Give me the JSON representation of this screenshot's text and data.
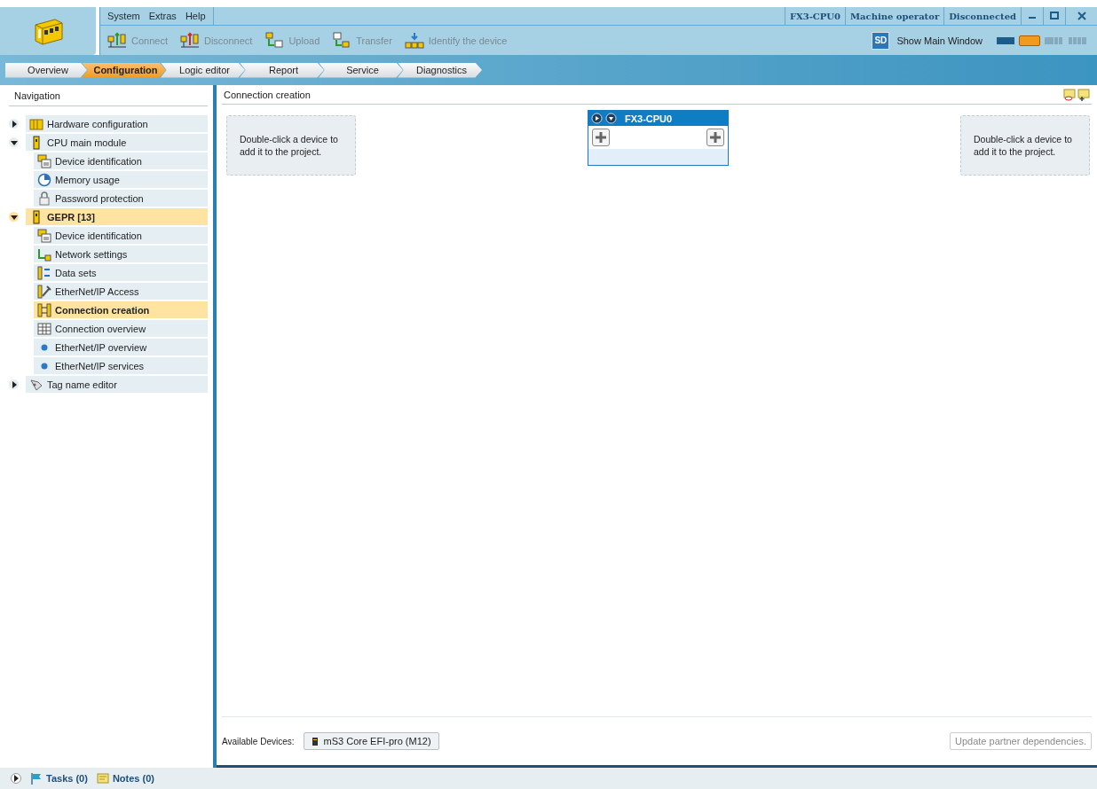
{
  "menu": [
    "System",
    "Extras",
    "Help"
  ],
  "status": [
    "FX3-CPU0",
    "Machine operator",
    "Disconnected"
  ],
  "toolbar": [
    {
      "label": "Connect",
      "kind": "connect",
      "disabled": true
    },
    {
      "label": "Disconnect",
      "kind": "disconnect",
      "disabled": true
    },
    {
      "label": "Upload",
      "kind": "upload",
      "disabled": true
    },
    {
      "label": "Transfer",
      "kind": "transfer",
      "disabled": true
    },
    {
      "label": "Identify the device",
      "kind": "identify",
      "disabled": true
    }
  ],
  "main_window": {
    "badge": "SD",
    "label": "Show Main Window"
  },
  "layouts": [
    {
      "kind": "single",
      "selected": false
    },
    {
      "kind": "split",
      "selected": true
    },
    {
      "kind": "triple",
      "selected": false
    },
    {
      "kind": "quad",
      "selected": false
    }
  ],
  "tabs": [
    {
      "label": "Overview",
      "selected": false
    },
    {
      "label": "Configuration",
      "selected": true
    },
    {
      "label": "Logic editor",
      "selected": false
    },
    {
      "label": "Report",
      "selected": false
    },
    {
      "label": "Service",
      "selected": false
    },
    {
      "label": "Diagnostics",
      "selected": false
    }
  ],
  "navigation": {
    "title": "Navigation",
    "items": [
      {
        "label": "Hardware configuration",
        "kind": "hardware",
        "expanded": false,
        "selected": false
      },
      {
        "label": "CPU main module",
        "kind": "module",
        "expanded": true,
        "selected": false,
        "children": [
          {
            "label": "Device identification",
            "kind": "device-id",
            "selected": false
          },
          {
            "label": "Memory usage",
            "kind": "memory",
            "selected": false
          },
          {
            "label": "Password protection",
            "kind": "password",
            "selected": false
          }
        ]
      },
      {
        "label": "GEPR [13]",
        "kind": "module",
        "expanded": true,
        "selected": true,
        "children": [
          {
            "label": "Device identification",
            "kind": "device-id",
            "selected": false
          },
          {
            "label": "Network settings",
            "kind": "network",
            "selected": false
          },
          {
            "label": "Data sets",
            "kind": "datasets",
            "selected": false
          },
          {
            "label": "EtherNet/IP Access",
            "kind": "access",
            "selected": false
          },
          {
            "label": "Connection creation",
            "kind": "connection",
            "selected": true
          },
          {
            "label": "Connection overview",
            "kind": "table",
            "selected": false
          },
          {
            "label": "EtherNet/IP overview",
            "kind": "dot",
            "selected": false
          },
          {
            "label": "EtherNet/IP services",
            "kind": "dot",
            "selected": false
          }
        ]
      },
      {
        "label": "Tag name editor",
        "kind": "tag",
        "expanded": false,
        "selected": false
      }
    ]
  },
  "content": {
    "title": "Connection creation",
    "drop_left": "Double-click a device to add it to the project.",
    "device_node": {
      "title": "FX3-CPU0"
    },
    "drop_right": "Double-click a device to add it to the project.",
    "available_label": "Available Devices:",
    "available_devices": [
      "mS3 Core EFI-pro (M12)"
    ],
    "update_button": {
      "label": "Update partner dependencies.",
      "disabled": true
    }
  },
  "status_bar": {
    "items": [
      {
        "label": "Tasks (0)",
        "kind": "tasks"
      },
      {
        "label": "Notes (0)",
        "kind": "notes"
      }
    ]
  }
}
